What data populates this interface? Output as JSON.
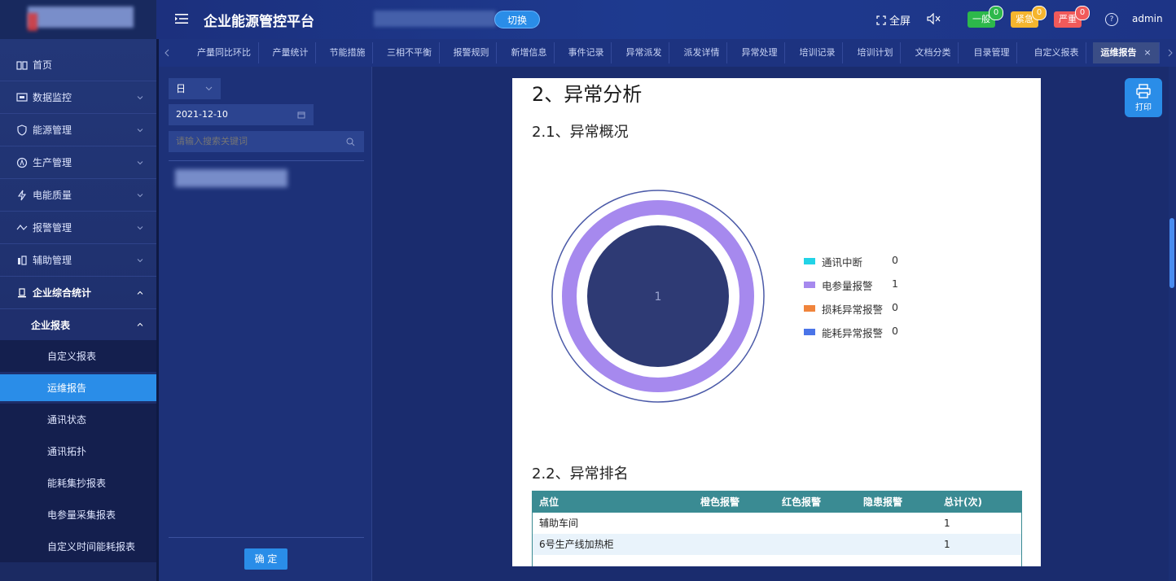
{
  "header": {
    "title": "企业能源管控平台",
    "switch_label": "切换",
    "fullscreen_label": "全屏",
    "alarms": [
      {
        "label": "一般",
        "count": "0",
        "color": "#2db84b"
      },
      {
        "label": "紧急",
        "count": "0",
        "color": "#f5b52e"
      },
      {
        "label": "严重",
        "count": "0",
        "color": "#f05a5a"
      }
    ],
    "user": "admin"
  },
  "sidebar": {
    "items": [
      {
        "label": "首页",
        "icon": "home-icon"
      },
      {
        "label": "数据监控",
        "icon": "monitor-icon"
      },
      {
        "label": "能源管理",
        "icon": "shield-icon"
      },
      {
        "label": "生产管理",
        "icon": "production-icon"
      },
      {
        "label": "电能质量",
        "icon": "lightning-icon"
      },
      {
        "label": "报警管理",
        "icon": "alarm-icon"
      },
      {
        "label": "辅助管理",
        "icon": "assist-icon"
      },
      {
        "label": "企业综合统计",
        "icon": "statistics-icon"
      }
    ],
    "group_label": "企业报表",
    "sub_items": [
      "自定义报表",
      "运维报告",
      "通讯状态",
      "通讯拓扑",
      "能耗集抄报表",
      "电参量采集报表",
      "自定义时间能耗报表"
    ],
    "active_sub": "运维报告"
  },
  "tabs": [
    "产量同比环比",
    "产量统计",
    "节能措施",
    "三相不平衡",
    "报警规则",
    "新增信息",
    "事件记录",
    "异常派发",
    "派发详情",
    "异常处理",
    "培训记录",
    "培训计划",
    "文档分类",
    "目录管理",
    "自定义报表",
    "运维报告"
  ],
  "active_tab": "运维报告",
  "filter": {
    "period": "日",
    "date": "2021-12-10",
    "search_placeholder": "请输入搜索关键词",
    "confirm_label": "确 定"
  },
  "report": {
    "section_title": "2、异常分析",
    "overview_title": "2.1、异常概况",
    "ranking_title": "2.2、异常排名",
    "table": {
      "headers": [
        "点位",
        "橙色报警",
        "红色报警",
        "隐患报警",
        "总计(次)"
      ],
      "rows": [
        [
          "辅助车间",
          "",
          "",
          "",
          "1"
        ],
        [
          "6号生产线加热柜",
          "",
          "",
          "",
          "1"
        ]
      ]
    }
  },
  "chart_data": {
    "type": "pie",
    "categories": [
      "通讯中断",
      "电参量报警",
      "损耗异常报警",
      "能耗异常报警"
    ],
    "values": [
      0,
      1,
      0,
      0
    ],
    "colors": [
      "#22d3e6",
      "#a689ee",
      "#f0843c",
      "#4a74e8"
    ],
    "center_label": "1",
    "legend": "right"
  },
  "print_label": "打印"
}
